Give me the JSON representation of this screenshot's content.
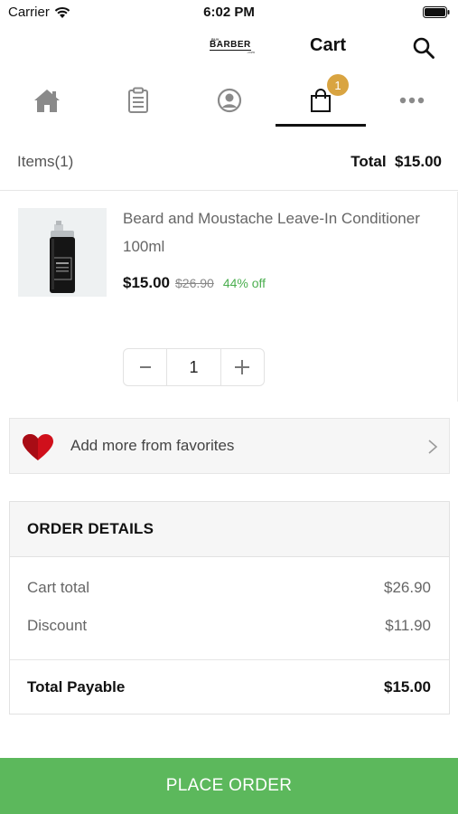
{
  "status_bar": {
    "carrier": "Carrier",
    "time": "6:02 PM"
  },
  "header": {
    "logo": {
      "top": "BUY",
      "word": "BARBER",
      "bottom": ".com"
    },
    "title": "Cart"
  },
  "nav": {
    "items": [
      {
        "icon": "home-icon"
      },
      {
        "icon": "clipboard-icon"
      },
      {
        "icon": "profile-icon"
      },
      {
        "icon": "shopping-bag-icon",
        "active": true,
        "badge": "1"
      },
      {
        "icon": "more-icon"
      }
    ]
  },
  "summary": {
    "items": "Items(1)",
    "total": "Total  $15.00"
  },
  "product": {
    "name": "Beard and Moustache Leave-In Conditioner 100ml",
    "price": "$15.00",
    "old_price": "$26.90",
    "discount": "44% off",
    "quantity": "1"
  },
  "favorites": {
    "label": "Add more from favorites"
  },
  "order": {
    "title": "ORDER DETAILS",
    "cart_total_label": "Cart total",
    "cart_total_value": "$26.90",
    "discount_label": "Discount",
    "discount_value": "$11.90",
    "payable_label": "Total Payable",
    "payable_value": "$15.00"
  },
  "actions": {
    "place_order": "PLACE ORDER"
  },
  "colors": {
    "accent": "#5cb85c",
    "badge": "#d9a441",
    "discount": "#4caf50",
    "heart": "#d0101b"
  }
}
